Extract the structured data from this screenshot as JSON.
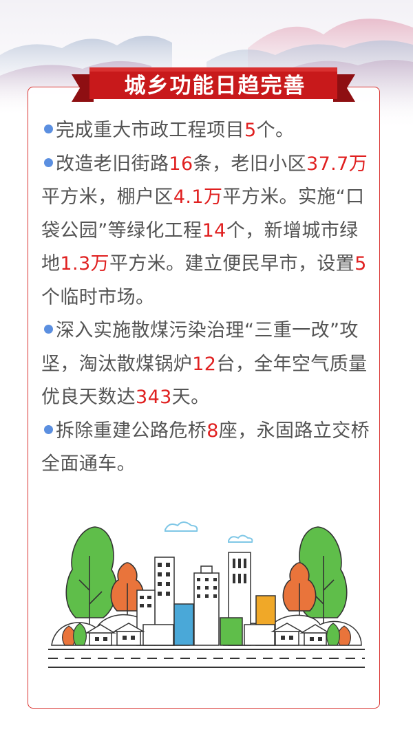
{
  "colors": {
    "banner": "#c8191b",
    "highlight": "#e02020",
    "text": "#545454",
    "bullet": "#5b8fe0",
    "card_border": "#d9322e"
  },
  "banner": {
    "title": "城乡功能日趋完善"
  },
  "paragraphs": [
    {
      "parts": [
        {
          "text": "完成重大市政工程项目",
          "hl": false
        },
        {
          "text": "5",
          "hl": true
        },
        {
          "text": "个。",
          "hl": false
        }
      ]
    },
    {
      "parts": [
        {
          "text": "改造老旧街路",
          "hl": false
        },
        {
          "text": "16",
          "hl": true
        },
        {
          "text": "条，老旧小区",
          "hl": false
        },
        {
          "text": "37.7万",
          "hl": true
        },
        {
          "text": "平方米，棚户区",
          "hl": false
        },
        {
          "text": "4.1万",
          "hl": true
        },
        {
          "text": "平方米。实施“口袋公园”等绿化工程",
          "hl": false
        },
        {
          "text": "14",
          "hl": true
        },
        {
          "text": "个，新增城市绿地",
          "hl": false
        },
        {
          "text": "1.3万",
          "hl": true
        },
        {
          "text": "平方米。建立便民早市，设置",
          "hl": false
        },
        {
          "text": "5",
          "hl": true
        },
        {
          "text": "个临时市场。",
          "hl": false
        }
      ]
    },
    {
      "parts": [
        {
          "text": "深入实施散煤污染治理“三重一改”攻坚，淘汰散煤锅炉",
          "hl": false
        },
        {
          "text": "12",
          "hl": true
        },
        {
          "text": "台，全年空气质量优良天数达",
          "hl": false
        },
        {
          "text": "343",
          "hl": true
        },
        {
          "text": "天。",
          "hl": false
        }
      ]
    },
    {
      "parts": [
        {
          "text": "拆除重建公路危桥",
          "hl": false
        },
        {
          "text": "8",
          "hl": true
        },
        {
          "text": "座，永固路立交桥全面通车。",
          "hl": false
        }
      ]
    }
  ],
  "illustration": {
    "icon": "city-skyline-illustration"
  }
}
